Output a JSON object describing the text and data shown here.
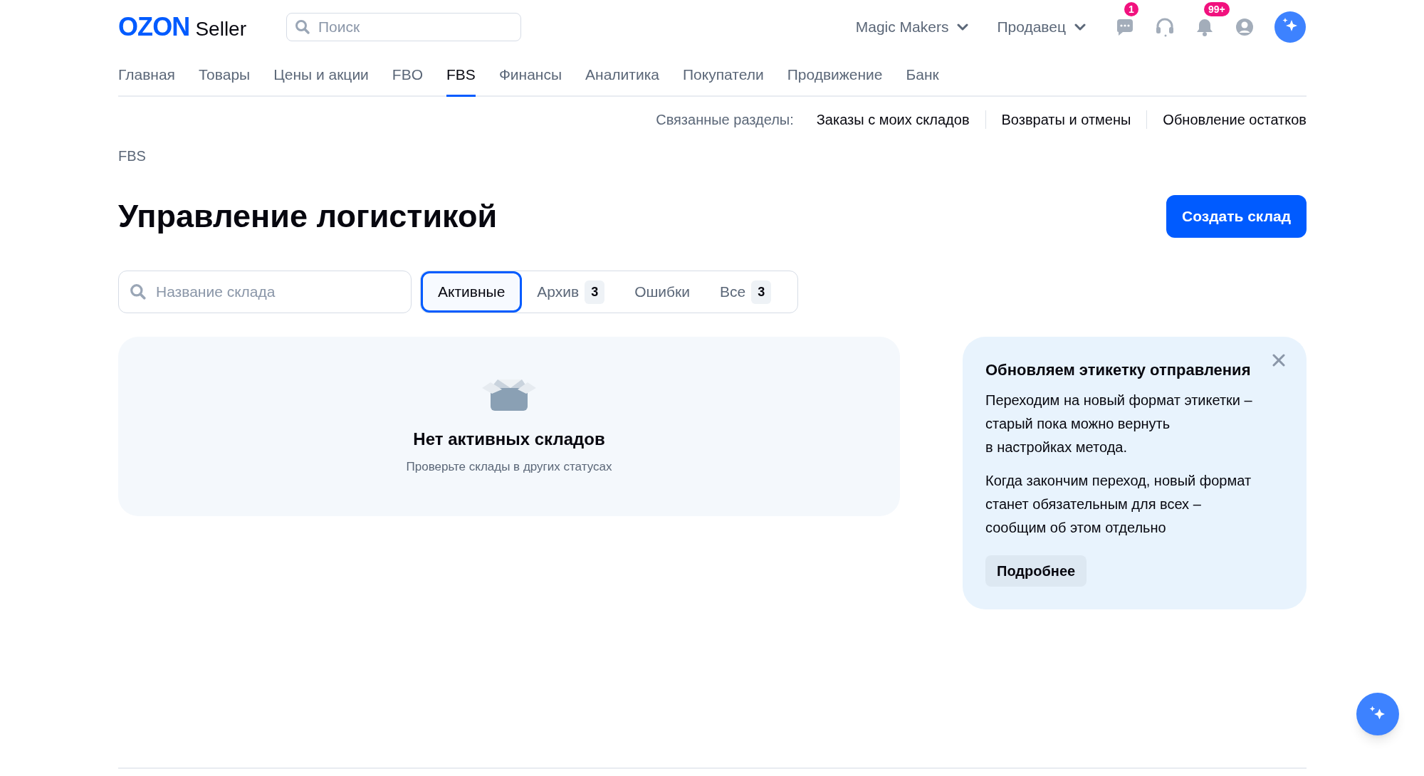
{
  "header": {
    "logo": "OZON",
    "logo_suffix": "Seller",
    "search": {
      "placeholder": "Поиск"
    },
    "account": "Magic Makers",
    "role": "Продавец",
    "icons": [
      {
        "kind": "chat",
        "badge": "1"
      },
      {
        "kind": "support"
      },
      {
        "kind": "bell",
        "badge": "99+"
      },
      {
        "kind": "profile"
      },
      {
        "kind": "assistant"
      }
    ]
  },
  "nav": [
    {
      "label": "Главная",
      "selected": false
    },
    {
      "label": "Товары",
      "selected": false
    },
    {
      "label": "Цены и акции",
      "selected": false
    },
    {
      "label": "FBO",
      "selected": false
    },
    {
      "label": "FBS",
      "selected": true
    },
    {
      "label": "Финансы",
      "selected": false
    },
    {
      "label": "Аналитика",
      "selected": false
    },
    {
      "label": "Покупатели",
      "selected": false
    },
    {
      "label": "Продвижение",
      "selected": false
    },
    {
      "label": "Банк",
      "selected": false
    }
  ],
  "related": {
    "label": "Связанные разделы:",
    "links": [
      "Заказы с моих складов",
      "Возвраты и отмены",
      "Обновление остатков"
    ]
  },
  "breadcrumb": "FBS",
  "title": "Управление логистикой",
  "create_button": "Создать склад",
  "filter": {
    "search": {
      "placeholder": "Название склада"
    },
    "tabs": [
      {
        "label": "Активные",
        "selected": true
      },
      {
        "label": "Архив",
        "count": "3",
        "selected": false
      },
      {
        "label": "Ошибки",
        "selected": false
      },
      {
        "label": "Все",
        "count": "3",
        "selected": false
      }
    ]
  },
  "empty": {
    "title": "Нет активных складов",
    "subtitle": "Проверьте склады в других статусах"
  },
  "notice": {
    "title": "Обновляем этикетку отправления",
    "paragraphs": [
      "Переходим на новый формат этикетки –\nстарый пока можно вернуть\nв настройках метода.",
      "Когда закончим переход, новый формат\nстанет обязательным для всех –\nсообщим об этом отдельно"
    ],
    "button": "Подробнее"
  }
}
